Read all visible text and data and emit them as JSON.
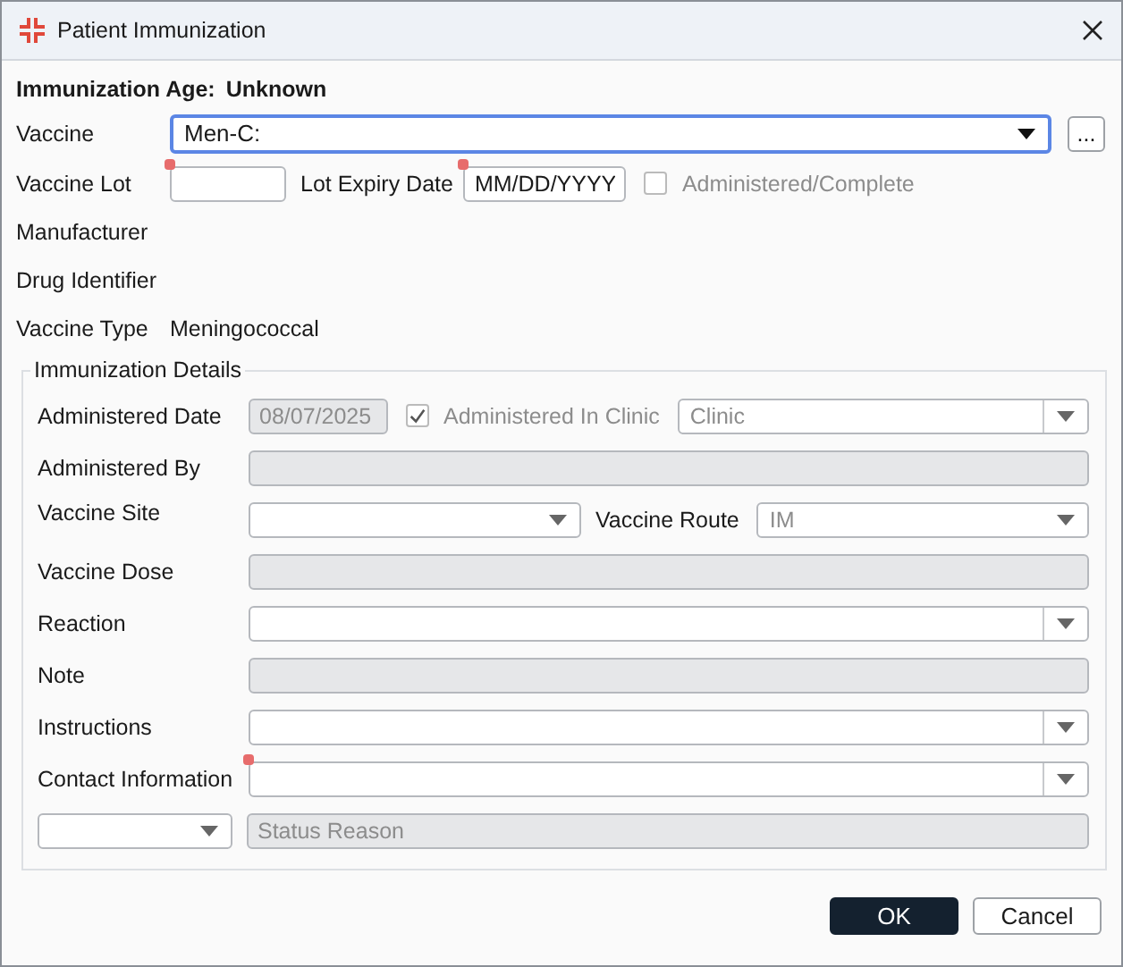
{
  "window": {
    "title": "Patient Immunization"
  },
  "age": {
    "label": "Immunization Age:",
    "value": "Unknown"
  },
  "vaccine": {
    "label": "Vaccine",
    "value": "Men-C:",
    "focused": true,
    "more_button": "..."
  },
  "lot": {
    "label": "Vaccine Lot",
    "required": true
  },
  "expiry": {
    "label": "Lot Expiry Date",
    "placeholder": "MM/DD/YYYY",
    "required": true
  },
  "administered_complete": {
    "label": "Administered/Complete",
    "checked": false,
    "disabled": true
  },
  "manufacturer": {
    "label": "Manufacturer"
  },
  "drug_identifier": {
    "label": "Drug Identifier"
  },
  "vaccine_type": {
    "label": "Vaccine Type",
    "value": "Meningococcal"
  },
  "details": {
    "title": "Immunization Details",
    "administered_date": {
      "label": "Administered Date",
      "value": "08/07/2025",
      "disabled": true
    },
    "in_clinic": {
      "label": "Administered In Clinic",
      "checked": true,
      "disabled": true
    },
    "clinic": {
      "value": "Clinic",
      "disabled": true
    },
    "administered_by": {
      "label": "Administered By",
      "disabled": true
    },
    "site": {
      "label": "Vaccine Site",
      "disabled": false
    },
    "route": {
      "label": "Vaccine Route",
      "value": "IM",
      "disabled": true
    },
    "dose": {
      "label": "Vaccine Dose",
      "disabled": true
    },
    "reaction": {
      "label": "Reaction",
      "disabled": false
    },
    "note": {
      "label": "Note",
      "disabled": true
    },
    "instructions": {
      "label": "Instructions",
      "disabled": false
    },
    "contact": {
      "label": "Contact Information",
      "required": true,
      "disabled": false
    },
    "status": {
      "disabled": false
    },
    "status_reason": {
      "placeholder": "Status Reason",
      "disabled": true
    }
  },
  "buttons": [
    {
      "label": "OK",
      "kind": "primary"
    },
    {
      "label": "Cancel",
      "kind": "secondary"
    }
  ]
}
